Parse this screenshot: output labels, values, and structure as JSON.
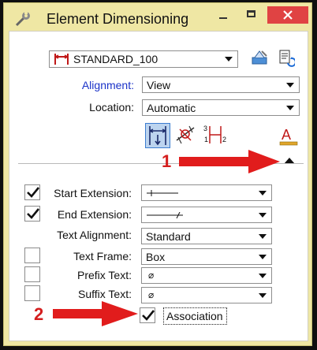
{
  "window": {
    "title": "Element Dimensioning"
  },
  "style_select": {
    "value": "STANDARD_100",
    "icon": "dimension-style-icon"
  },
  "alignment": {
    "label": "Alignment:",
    "value": "View"
  },
  "location": {
    "label": "Location:",
    "value": "Automatic"
  },
  "fields": {
    "start_extension": {
      "label": "Start Extension:",
      "checked": true
    },
    "end_extension": {
      "label": "End Extension:",
      "checked": true
    },
    "text_alignment": {
      "label": "Text Alignment:",
      "value": "Standard"
    },
    "text_frame": {
      "label": "Text Frame:",
      "value": "Box",
      "checked": false
    },
    "prefix_text": {
      "label": "Prefix Text:",
      "value": "⌀",
      "checked": false
    },
    "suffix_text": {
      "label": "Suffix Text:",
      "value": "⌀",
      "checked": false
    }
  },
  "association": {
    "label": "Association",
    "checked": true
  },
  "annotations": {
    "marker_1": "1",
    "marker_2": "2"
  },
  "colors": {
    "title_bar": "#efe7a4",
    "close_button": "#e04343",
    "callout": "#d41e1e",
    "link_label": "#1a32c8"
  }
}
